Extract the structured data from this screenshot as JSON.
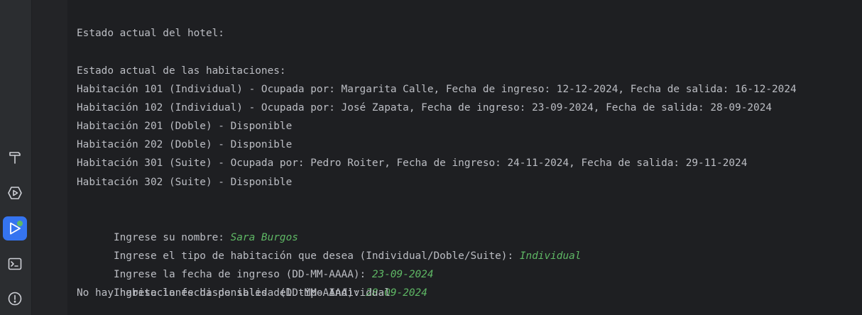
{
  "toolbar": {
    "items": [
      {
        "name": "build-tool",
        "icon": "hammer-icon"
      },
      {
        "name": "services-tool",
        "icon": "services-icon"
      },
      {
        "name": "run-tool",
        "icon": "run-icon",
        "active": true,
        "status_color": "#5fb865"
      },
      {
        "name": "terminal-tool",
        "icon": "terminal-icon"
      },
      {
        "name": "problems-tool",
        "icon": "problems-icon"
      }
    ]
  },
  "console": {
    "partial_top_line": "{                                    (   )",
    "lines": [
      {
        "text": ""
      },
      {
        "text": "Estado actual del hotel:"
      },
      {
        "text": ""
      },
      {
        "text": "Estado actual de las habitaciones:"
      },
      {
        "text": "Habitación 101 (Individual) - Ocupada por: Margarita Calle, Fecha de ingreso: 12-12-2024, Fecha de salida: 16-12-2024"
      },
      {
        "text": "Habitación 102 (Individual) - Ocupada por: José Zapata, Fecha de ingreso: 23-09-2024, Fecha de salida: 28-09-2024"
      },
      {
        "text": "Habitación 201 (Doble) - Disponible"
      },
      {
        "text": "Habitación 202 (Doble) - Disponible"
      },
      {
        "text": "Habitación 301 (Suite) - Ocupada por: Pedro Roiter, Fecha de ingreso: 24-11-2024, Fecha de salida: 29-11-2024"
      },
      {
        "text": "Habitación 302 (Suite) - Disponible"
      },
      {
        "text": ""
      },
      {
        "prompt": "Ingrese su nombre: ",
        "input": "Sara Burgos"
      },
      {
        "prompt": "Ingrese el tipo de habitación que desea (Individual/Doble/Suite): ",
        "input": "Individual"
      },
      {
        "prompt": "Ingrese la fecha de ingreso (DD-MM-AAAA): ",
        "input": "23-09-2024"
      },
      {
        "prompt": "Ingrese la fecha de salida (DD-MM-AAAA): ",
        "input": "28-09-2024"
      },
      {
        "text": "No hay habitaciones disponibles del tipo Individual"
      }
    ]
  },
  "colors": {
    "background": "#1e1f22",
    "sidebar": "#2b2d30",
    "text": "#bcbec4",
    "user_input": "#5fb865",
    "accent": "#3574f0"
  }
}
